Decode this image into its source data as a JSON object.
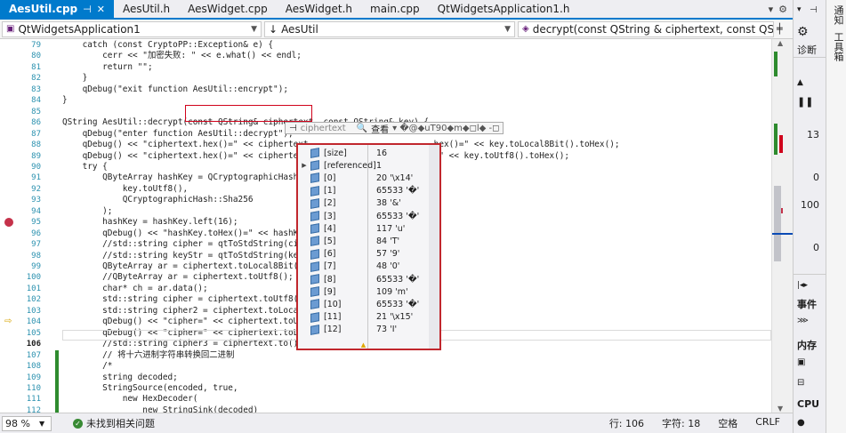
{
  "tabs": [
    {
      "label": "AesUtil.cpp",
      "active": true
    },
    {
      "label": "AesUtil.h"
    },
    {
      "label": "AesWidget.cpp"
    },
    {
      "label": "AesWidget.h"
    },
    {
      "label": "main.cpp"
    },
    {
      "label": "QtWidgetsApplication1.h"
    }
  ],
  "tab_tools": {
    "dropdown": "▾",
    "settings": "⚙"
  },
  "navbar": {
    "project": "QtWidgetsApplication1",
    "scope": "AesUtil",
    "member": "decrypt(const QString & ciphertext, const QString & key)"
  },
  "code_lines": [
    {
      "no": "79",
      "text": "    catch (const CryptoPP::Exception& e) {"
    },
    {
      "no": "80",
      "text": "        cerr << \"加密失败: \" << e.what() << endl;"
    },
    {
      "no": "81",
      "text": "        return \"\";"
    },
    {
      "no": "82",
      "text": "    }"
    },
    {
      "no": "83",
      "text": "    qDebug(\"exit function AesUtil::encrypt\");"
    },
    {
      "no": "84",
      "text": "}"
    },
    {
      "no": "85",
      "text": ""
    },
    {
      "no": "86",
      "text": "QString AesUtil::decrypt(const QString& ciphertext, const QString& key) {"
    },
    {
      "no": "87",
      "text": "    qDebug(\"enter function AesUtil::decrypt\");"
    },
    {
      "no": "88",
      "text": "    qDebug() << \"ciphertext.hex()=\" << ciphertext                        .hex()=\" << key.toLocal8Bit().toHex();"
    },
    {
      "no": "89",
      "text": "    qDebug() << \"ciphertext.hex()=\" << ciphertext                        )=\" << key.toUtf8().toHex();"
    },
    {
      "no": "90",
      "text": "    try {"
    },
    {
      "no": "91",
      "text": "        QByteArray hashKey = QCryptographicHash::"
    },
    {
      "no": "92",
      "text": "            key.toUtf8(),"
    },
    {
      "no": "93",
      "text": "            QCryptographicHash::Sha256"
    },
    {
      "no": "94",
      "text": "        );"
    },
    {
      "no": "95",
      "text": "        hashKey = hashKey.left(16);"
    },
    {
      "no": "96",
      "text": "        qDebug() << \"hashKey.toHex()=\" << hashKe"
    },
    {
      "no": "97",
      "text": "        //std::string cipher = qtToStdString(ci"
    },
    {
      "no": "98",
      "text": "        //std::string keyStr = qtToStdString(ke"
    },
    {
      "no": "99",
      "text": "        QByteArray ar = ciphertext.toLocal8Bit("
    },
    {
      "no": "100",
      "text": "        //QByteArray ar = ciphertext.toUtf8();"
    },
    {
      "no": "101",
      "text": "        char* ch = ar.data();"
    },
    {
      "no": "102",
      "text": "        std::string cipher = ciphertext.toUtf8("
    },
    {
      "no": "103",
      "text": "        std::string cipher2 = ciphertext.toLoca"
    },
    {
      "no": "104",
      "text": "        qDebug() << \"cipher=\" << ciphertext.toU                      ≤3ms"
    },
    {
      "no": "105",
      "text": "        qDebug() << \"cipher=\" << ciphertext.toL"
    },
    {
      "no": "106",
      "text": "        //std::string cipher3 = ciphertext.to()."
    },
    {
      "no": "107",
      "text": "        // 将十六进制字符串转换回二进制"
    },
    {
      "no": "108",
      "text": "        /*"
    },
    {
      "no": "109",
      "text": "        string decoded;"
    },
    {
      "no": "110",
      "text": "        StringSource(encoded, true,"
    },
    {
      "no": "111",
      "text": "            new HexDecoder("
    },
    {
      "no": "112",
      "text": "                new StringSink(decoded)"
    },
    {
      "no": "113",
      "text": "            )"
    }
  ],
  "datatip": {
    "name": "ciphertext",
    "view_label": "查看",
    "value": "▾ �@◆uT90◆m◆◻l◆ -◻"
  },
  "watch_items": [
    {
      "name": "[size]",
      "value": "16",
      "expandable": false,
      "icon": "cube-icon"
    },
    {
      "name": "[referenced]",
      "value": "1",
      "expandable": true,
      "icon": "cube-icon"
    },
    {
      "name": "[0]",
      "value": "20 '\\x14'",
      "icon": "cube-icon"
    },
    {
      "name": "[1]",
      "value": "65533 '�'",
      "icon": "cube-icon"
    },
    {
      "name": "[2]",
      "value": "38 '&'",
      "icon": "cube-icon"
    },
    {
      "name": "[3]",
      "value": "65533 '�'",
      "icon": "cube-icon"
    },
    {
      "name": "[4]",
      "value": "117 'u'",
      "icon": "cube-icon"
    },
    {
      "name": "[5]",
      "value": "84 'T'",
      "icon": "cube-icon"
    },
    {
      "name": "[6]",
      "value": "57 '9'",
      "icon": "cube-icon"
    },
    {
      "name": "[7]",
      "value": "48 '0'",
      "icon": "cube-icon"
    },
    {
      "name": "[8]",
      "value": "65533 '�'",
      "icon": "cube-icon"
    },
    {
      "name": "[9]",
      "value": "109 'm'",
      "icon": "cube-icon"
    },
    {
      "name": "[10]",
      "value": "65533 '�'",
      "icon": "cube-icon"
    },
    {
      "name": "[11]",
      "value": "21 '\\x15'",
      "icon": "cube-icon"
    },
    {
      "name": "[12]",
      "value": "73 'I'",
      "icon": "cube-icon"
    }
  ],
  "status": {
    "zoom": "98 %",
    "issues": "未找到相关问题",
    "line": "行: 106",
    "col": "字符: 18",
    "spaces": "空格",
    "eol": "CRLF"
  },
  "right_panel": {
    "side_tab_1": "通知",
    "side_tab_2": "工具箱",
    "diag_label": "诊断",
    "values": [
      "13",
      "0",
      "100",
      "0"
    ],
    "events_label": "事件",
    "memory_label": "内存",
    "cpu_label": "CPU"
  },
  "colors": {
    "accent": "#007acc",
    "breakpoint": "#c5324a",
    "highlight": "#d0021b",
    "change_bar": "#2e8b2e"
  }
}
